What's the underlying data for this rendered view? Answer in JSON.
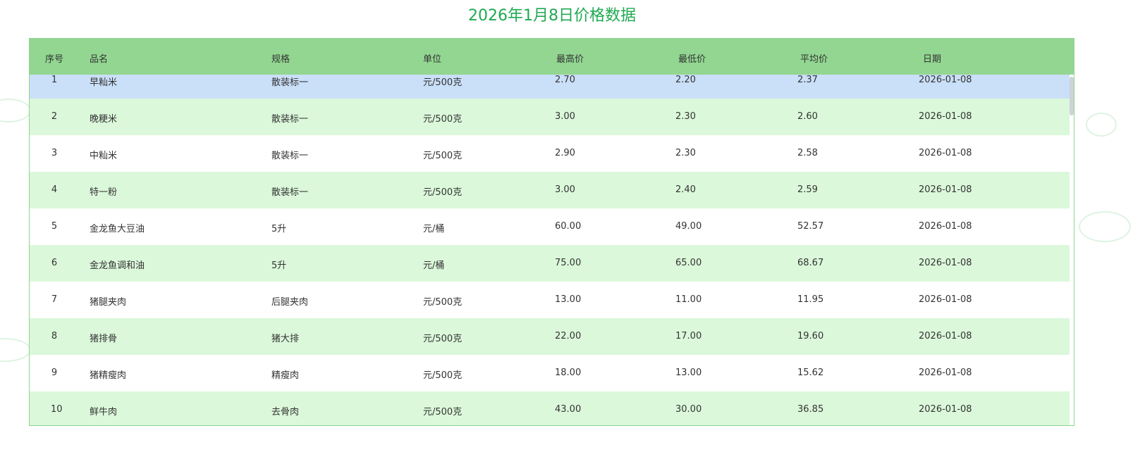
{
  "title": "2026年1月8日价格数据",
  "columns": [
    "序号",
    "品名",
    "规格",
    "单位",
    "最高价",
    "最低价",
    "平均价",
    "日期"
  ],
  "rows": [
    [
      "1",
      "早籼米",
      "散装标一",
      "元/500克",
      "2.70",
      "2.20",
      "2.37",
      "2026-01-08"
    ],
    [
      "2",
      "晚粳米",
      "散装标一",
      "元/500克",
      "3.00",
      "2.30",
      "2.60",
      "2026-01-08"
    ],
    [
      "3",
      "中籼米",
      "散装标一",
      "元/500克",
      "2.90",
      "2.30",
      "2.58",
      "2026-01-08"
    ],
    [
      "4",
      "特一粉",
      "散装标一",
      "元/500克",
      "3.00",
      "2.40",
      "2.59",
      "2026-01-08"
    ],
    [
      "5",
      "金龙鱼大豆油",
      "5升",
      "元/桶",
      "60.00",
      "49.00",
      "52.57",
      "2026-01-08"
    ],
    [
      "6",
      "金龙鱼调和油",
      "5升",
      "元/桶",
      "75.00",
      "65.00",
      "68.67",
      "2026-01-08"
    ],
    [
      "7",
      "猪腿夹肉",
      "后腿夹肉",
      "元/500克",
      "13.00",
      "11.00",
      "11.95",
      "2026-01-08"
    ],
    [
      "8",
      "猪排骨",
      "猪大排",
      "元/500克",
      "22.00",
      "17.00",
      "19.60",
      "2026-01-08"
    ],
    [
      "9",
      "猪精瘦肉",
      "精瘦肉",
      "元/500克",
      "18.00",
      "13.00",
      "15.62",
      "2026-01-08"
    ],
    [
      "10",
      "鲜牛肉",
      "去骨肉",
      "元/500克",
      "43.00",
      "30.00",
      "36.85",
      "2026-01-08"
    ]
  ]
}
